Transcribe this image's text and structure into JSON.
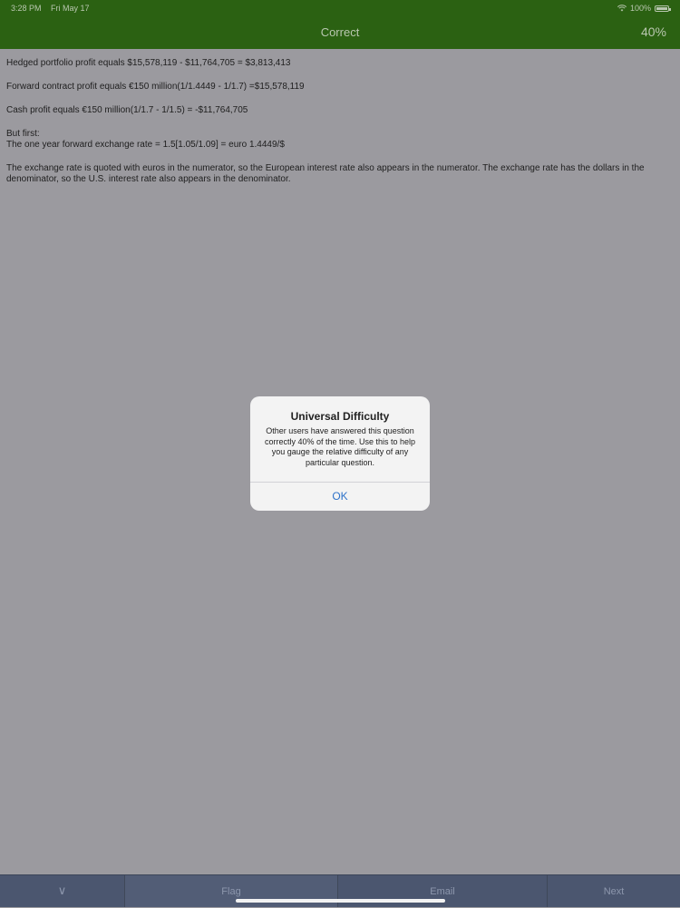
{
  "status_bar": {
    "time": "3:28 PM",
    "date": "Fri May 17",
    "battery": "100%",
    "icons": [
      "wifi-icon",
      "battery-icon"
    ]
  },
  "nav": {
    "title": "Correct",
    "percent": "40%"
  },
  "content": {
    "line1": "Hedged portfolio profit equals $15,578,119 - $11,764,705 = $3,813,413",
    "line2": "Forward contract profit equals €150 million(1/1.4449 - 1/1.7) =$15,578,119",
    "line3": "Cash profit equals €150 million(1/1.7 - 1/1.5) = -$11,764,705",
    "line4a": "But first:",
    "line4b": "The one year forward exchange rate = 1.5[1.05/1.09] = euro 1.4449/$",
    "line5": "The exchange rate is quoted with euros in the numerator, so the European interest rate also appears in the numerator. The exchange rate has the dollars in the denominator, so the U.S. interest rate also appears in the denominator."
  },
  "dialog": {
    "title": "Universal Difficulty",
    "message": "Other users have answered this question correctly 40% of the time. Use this to help you gauge the relative difficulty of any particular question.",
    "ok_label": "OK"
  },
  "toolbar": {
    "down_icon": "chevron-down-icon",
    "down_glyph": "∨",
    "flag_label": "Flag",
    "email_label": "Email",
    "next_label": "Next"
  },
  "colors": {
    "nav_bg": "#2b6112",
    "overlay_bg": "#9b9a9f",
    "toolbar_bg": "#4b566f",
    "dialog_button": "#2e72c9"
  }
}
